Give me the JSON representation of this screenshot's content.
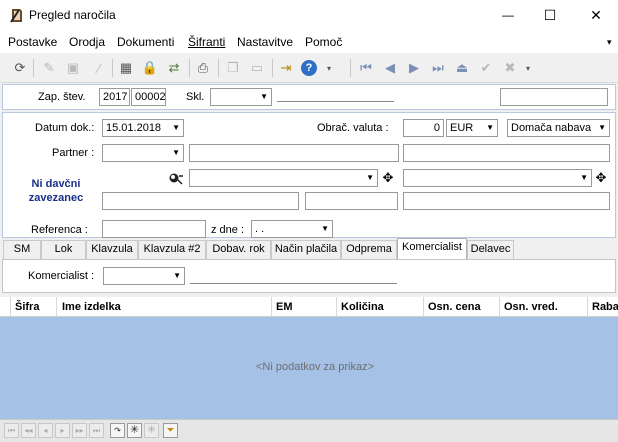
{
  "window": {
    "title": "Pregled naročila",
    "minimize": "—",
    "maximize": "☐",
    "close": "✕"
  },
  "menu": [
    "Postavke",
    "Orodja",
    "Dokumenti",
    "Šifranti",
    "Nastavitve",
    "Pomoč"
  ],
  "menu_overflow": "▾",
  "form": {
    "zap_stev_label": "Zap. štev.",
    "zap_year": "2017",
    "zap_num": "00002",
    "skl_label": "Skl.",
    "skl_value": "",
    "datum_label": "Datum dok.:",
    "datum_value": "15.01.2018",
    "obrac_label": "Obrač. valuta :",
    "obrac_amount": "0",
    "currency": "EUR",
    "nabava": "Domača nabava",
    "partner_label": "Partner :",
    "partner_value": "",
    "ni_davcni_label": "Ni davčni zavezanec",
    "referenca_label": "Referenca :",
    "z_dne_label": "z dne :",
    "z_dne_value": ". ."
  },
  "tabs": [
    "SM",
    "Lok",
    "Klavzula",
    "Klavzula #2",
    "Dobav. rok",
    "Način plačila",
    "Odprema",
    "Komercialist",
    "Delavec"
  ],
  "active_tab": "Komercialist",
  "komercialist": {
    "label": "Komercialist :",
    "value": ""
  },
  "grid": {
    "columns": [
      "Šifra",
      "Ime izdelka",
      "EM",
      "Količina",
      "Osn. cena",
      "Osn. vred.",
      "Raba"
    ],
    "empty_text": "<Ni podatkov za prikaz>"
  },
  "colors": {
    "grid_body": "#a5c1e6",
    "ni_davcni": "#1a2f8a",
    "panel_border": "#b9c7e0"
  }
}
